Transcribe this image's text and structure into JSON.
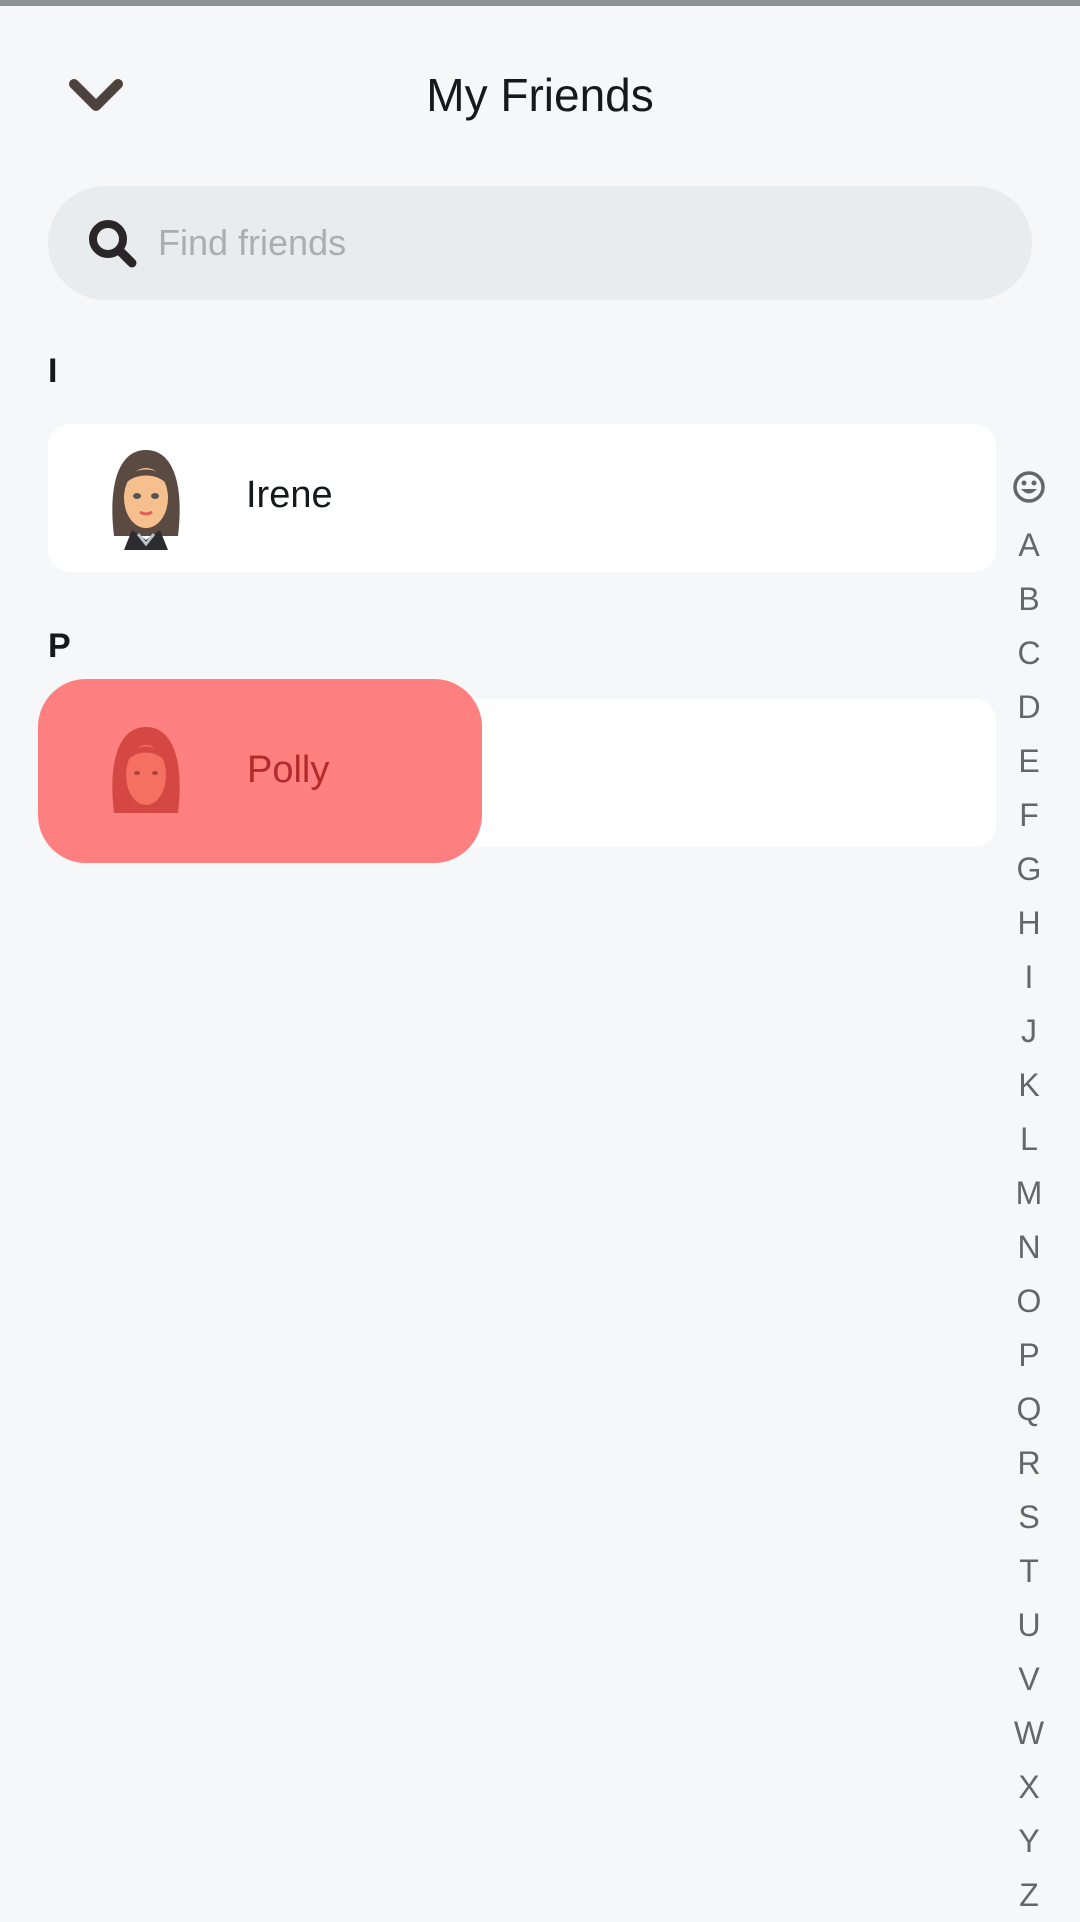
{
  "header": {
    "title": "My Friends",
    "back_icon": "chevron-down-icon"
  },
  "search": {
    "placeholder": "Find friends",
    "value": "",
    "icon": "search-icon"
  },
  "sections": [
    {
      "letter": "I",
      "friends": [
        {
          "name": "Irene",
          "avatar": "avatar-irene"
        }
      ]
    },
    {
      "letter": "P",
      "friends": [
        {
          "name": "Polly",
          "avatar": "avatar-polly",
          "highlighted": true
        }
      ]
    }
  ],
  "highlight_overlay": {
    "name": "Polly",
    "color": "#ff7f7f"
  },
  "alpha_index": {
    "emoji_icon": "smiley-icon",
    "letters": [
      "A",
      "B",
      "C",
      "D",
      "E",
      "F",
      "G",
      "H",
      "I",
      "J",
      "K",
      "L",
      "M",
      "N",
      "O",
      "P",
      "Q",
      "R",
      "S",
      "T",
      "U",
      "V",
      "W",
      "X",
      "Y",
      "Z"
    ]
  },
  "colors": {
    "background": "#f6f7f9",
    "search_bg": "#e8ecee",
    "card_bg": "#ffffff",
    "text": "#16191c",
    "index_text": "#646769",
    "highlight": "#ff7f7f",
    "highlight_text": "#b42a2a"
  }
}
